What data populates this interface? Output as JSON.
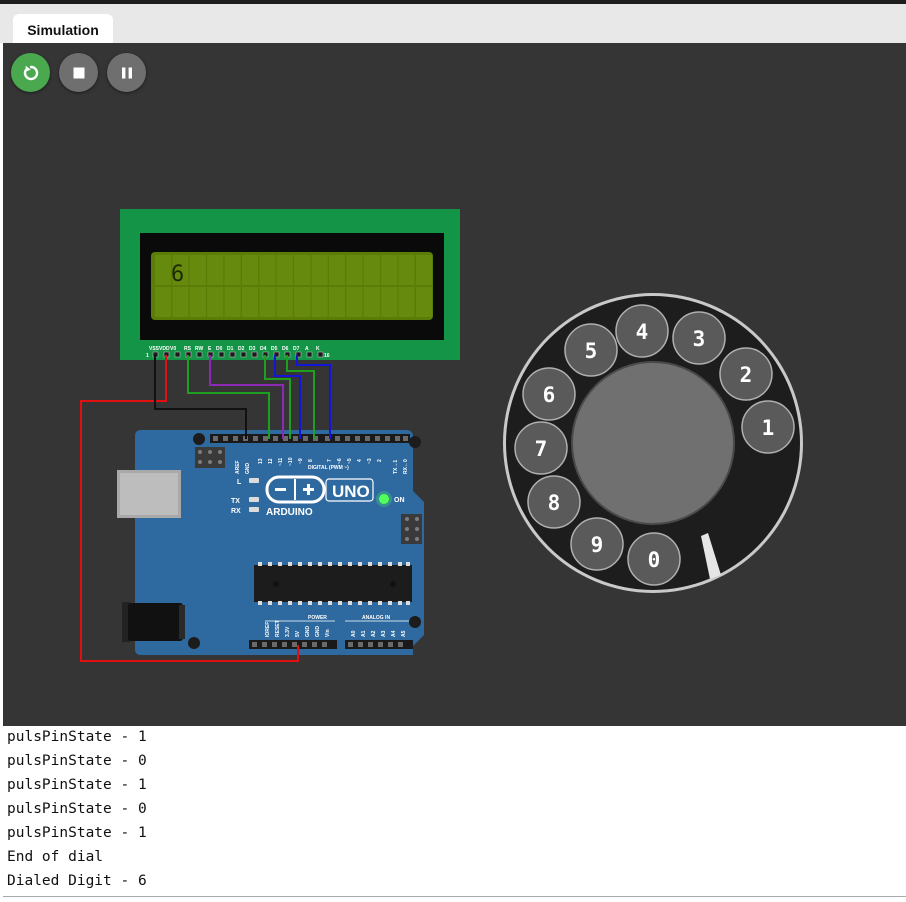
{
  "tabs": [
    {
      "label": "Simulation"
    }
  ],
  "controls": {
    "restart": "restart-icon",
    "stop": "stop-icon",
    "pause": "pause-icon"
  },
  "lcd": {
    "text": "6",
    "pin_labels": [
      "VSS",
      "VDD",
      "V0",
      "RS",
      "RW",
      "E",
      "D0",
      "D1",
      "D2",
      "D3",
      "D4",
      "D5",
      "D6",
      "D7",
      "A",
      "K"
    ],
    "pin_first": "1",
    "pin_last": "16"
  },
  "arduino": {
    "brand": "ARDUINO",
    "model": "UNO",
    "on_label": "ON",
    "l_label": "L",
    "tx_label": "TX",
    "rx_label": "RX",
    "aref": "AREF",
    "gnd": "GND",
    "digital_label": "DIGITAL (PWM ~)",
    "digital_pins": [
      "13",
      "12",
      "~11",
      "~10",
      "~9",
      "8",
      "7",
      "~6",
      "~5",
      "4",
      "~3",
      "2",
      "TX→1",
      "RX←0"
    ],
    "power_label": "POWER",
    "analog_label": "ANALOG IN",
    "power_pins": [
      "IOREF",
      "RESET",
      "3.3V",
      "5V",
      "GND",
      "GND",
      "Vin"
    ],
    "analog_pins": [
      "A0",
      "A1",
      "A2",
      "A3",
      "A4",
      "A5"
    ]
  },
  "dial": {
    "digits": [
      "1",
      "2",
      "3",
      "4",
      "5",
      "6",
      "7",
      "8",
      "9",
      "0"
    ]
  },
  "console": {
    "lines": [
      "pulsPinState - 1",
      "pulsPinState - 0",
      "pulsPinState - 1",
      "pulsPinState - 0",
      "pulsPinState - 1",
      "End of dial",
      "Dialed Digit - 6"
    ]
  },
  "colors": {
    "canvas": "#353535",
    "restart": "#4aa84e",
    "lcd_board": "#139446",
    "lcd_screen": "#5b7d07",
    "arduino_board": "#2e6aa0",
    "wire_red": "#e01010",
    "wire_black": "#111111",
    "wire_green": "#1f9e1f",
    "wire_purple": "#8c2ab3",
    "wire_blue": "#1515d8"
  }
}
